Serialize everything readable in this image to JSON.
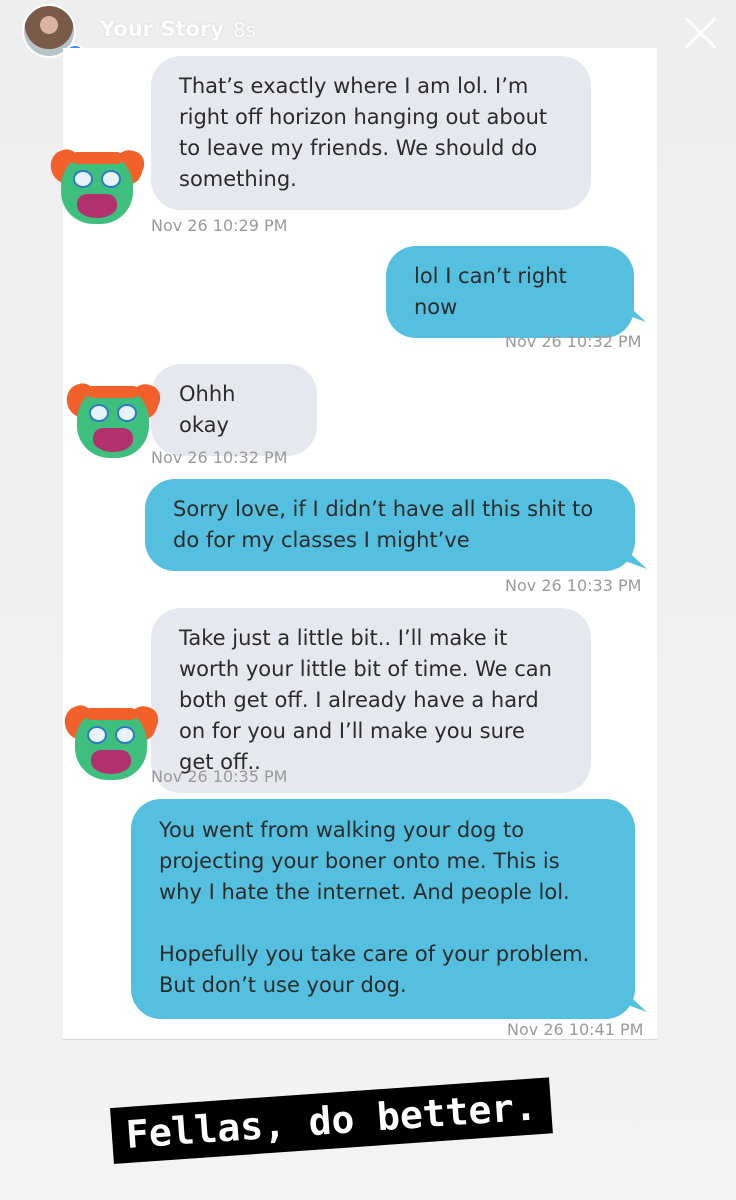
{
  "story": {
    "user": "Your Story",
    "time": "8s",
    "avatar_icon": "profile-avatar",
    "plus_icon": "+",
    "close_icon": "close-icon"
  },
  "conversation": {
    "messages": [
      {
        "side": "in",
        "text": "That’s exactly where I am lol. I’m right off horizon hanging out about to leave my friends. We should do something.",
        "timestamp": "Nov 26 10:29 PM"
      },
      {
        "side": "out",
        "text": "lol I can’t right now",
        "timestamp": "Nov 26 10:32 PM"
      },
      {
        "side": "in",
        "text": "Ohhh okay",
        "timestamp": "Nov 26 10:32 PM"
      },
      {
        "side": "out",
        "text": "Sorry love, if I didn’t have all this shit to do for my classes I might’ve",
        "timestamp": "Nov 26 10:33 PM"
      },
      {
        "side": "in",
        "text": "Take just a little bit.. I’ll make it worth your little bit of time. We can both get off. I already have a hard on for you and I’ll make you sure get off..",
        "timestamp": "Nov 26 10:35 PM"
      },
      {
        "side": "out",
        "text": "You went from walking your dog to projecting your boner onto me. This is why I hate the internet. And people lol.",
        "text2": "Hopefully you take care of your problem. But don’t use your dog.",
        "timestamp": "Nov 26 10:41 PM"
      }
    ]
  },
  "caption": "Fellas, do better.",
  "colors": {
    "incoming_bubble": "#e6e8ef",
    "outgoing_bubble": "#54bfdf",
    "timestamp": "#9a9a9a",
    "caption_bg": "#000000"
  }
}
